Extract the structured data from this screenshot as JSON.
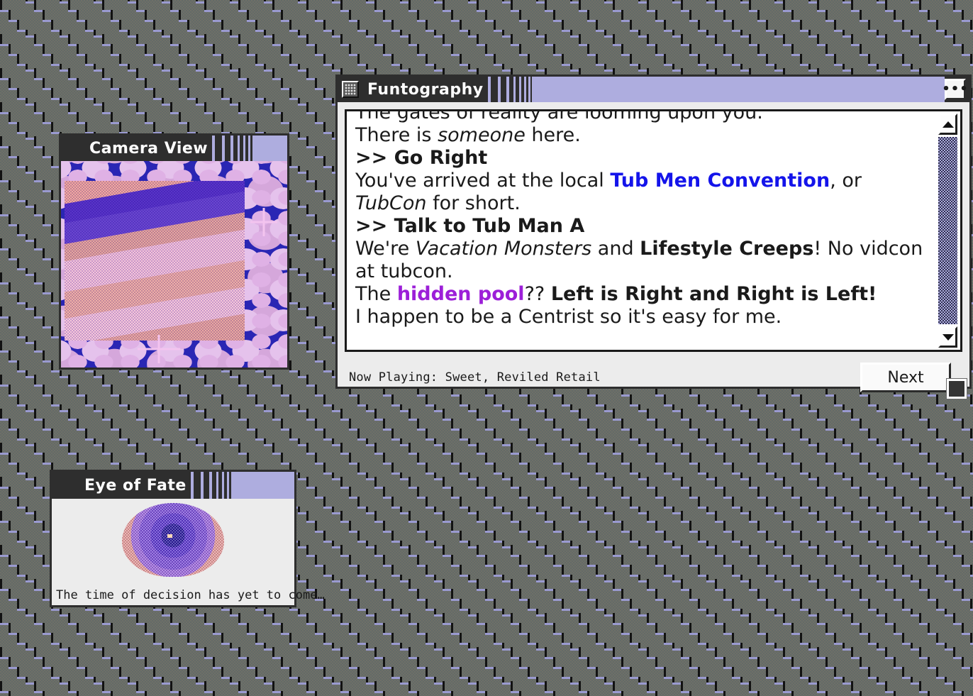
{
  "desktop": {
    "background_color": "#6b6b6b",
    "accent_lavender": "#aeaddf",
    "chrome_dark": "#2e2e2e",
    "face_gray": "#ececec"
  },
  "funtography": {
    "title": "Funtography",
    "icon": "window-grid-icon",
    "menu_button_label": "•••",
    "story_lines": [
      {
        "id": "line-1",
        "clipped": true,
        "parts": [
          {
            "text": "The gates of reality are looming upon you.",
            "style": "plain"
          }
        ]
      },
      {
        "id": "line-2",
        "parts": [
          {
            "text": "There is ",
            "style": "plain"
          },
          {
            "text": "someone",
            "style": "em"
          },
          {
            "text": " here.",
            "style": "plain"
          }
        ]
      },
      {
        "id": "line-3",
        "parts": [
          {
            "text": ">> Go Right",
            "style": "choice"
          }
        ]
      },
      {
        "id": "line-4",
        "parts": [
          {
            "text": "You've arrived at the local ",
            "style": "plain"
          },
          {
            "text": "Tub Men Convention",
            "style": "link-blue"
          },
          {
            "text": ", or ",
            "style": "plain"
          },
          {
            "text": "TubCon",
            "style": "em"
          },
          {
            "text": " for short.",
            "style": "plain"
          }
        ]
      },
      {
        "id": "line-5",
        "parts": [
          {
            "text": ">> Talk to Tub Man A",
            "style": "choice"
          }
        ]
      },
      {
        "id": "line-6",
        "parts": [
          {
            "text": "We're ",
            "style": "plain"
          },
          {
            "text": "Vacation Monsters",
            "style": "em"
          },
          {
            "text": " and ",
            "style": "plain"
          },
          {
            "text": "Lifestyle Creeps",
            "style": "strong"
          },
          {
            "text": "! No vidcon at tubcon.",
            "style": "plain"
          }
        ]
      },
      {
        "id": "line-7",
        "parts": [
          {
            "text": "The ",
            "style": "plain"
          },
          {
            "text": "hidden pool",
            "style": "link-purple"
          },
          {
            "text": "?? ",
            "style": "plain"
          },
          {
            "text": "Left is Right and Right is Left!",
            "style": "strong"
          }
        ]
      },
      {
        "id": "line-8",
        "parts": [
          {
            "text": "I happen to be a Centrist so it's easy for me.",
            "style": "plain"
          }
        ]
      }
    ],
    "scrollbar": {
      "up_arrow": "scroll-up-arrow",
      "down_arrow": "scroll-down-arrow",
      "track_color": "#aeaddf"
    },
    "status": {
      "now_playing": "Now Playing: Sweet, Reviled Retail"
    },
    "next_button_label": "Next",
    "resize_grip": "resize-grip"
  },
  "camera": {
    "title": "Camera View",
    "image_alt": "dithered starfield photo of a hot tub"
  },
  "eye": {
    "title": "Eye of Fate",
    "caption": "The time of decision has yet to come…",
    "image_alt": "dithered purple and pink eye"
  }
}
